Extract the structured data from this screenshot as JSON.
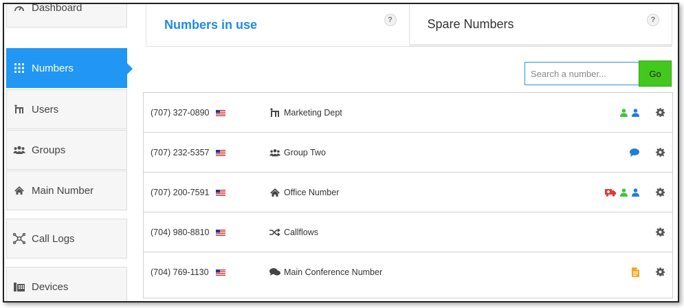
{
  "sidebar": {
    "items": [
      {
        "label": "Dashboard",
        "icon": "dashboard-icon"
      },
      {
        "label": "Numbers",
        "icon": "grid-icon",
        "active": true
      },
      {
        "label": "Users",
        "icon": "user-tree-icon"
      },
      {
        "label": "Groups",
        "icon": "group-icon"
      },
      {
        "label": "Main Number",
        "icon": "home-icon"
      },
      {
        "label": "Call Logs",
        "icon": "call-logs-icon"
      },
      {
        "label": "Devices",
        "icon": "device-icon"
      }
    ]
  },
  "tabs": [
    {
      "label": "Numbers in use",
      "help": "?"
    },
    {
      "label": "Spare Numbers",
      "help": "?"
    }
  ],
  "search": {
    "placeholder": "Search a number...",
    "go_label": "Go"
  },
  "numbers": [
    {
      "number": "(707) 327-0890",
      "owner": "Marketing Dept",
      "owner_icon": "user-tree-icon",
      "features": [
        "green-user-icon",
        "blue-user-icon"
      ]
    },
    {
      "number": "(707) 232-5357",
      "owner": "Group Two",
      "owner_icon": "group-icon",
      "features": [
        "chat-bubble-icon"
      ]
    },
    {
      "number": "(707) 200-7591",
      "owner": "Office Number",
      "owner_icon": "home-icon",
      "features": [
        "ambulance-icon",
        "green-user-icon",
        "blue-user-icon"
      ]
    },
    {
      "number": "(704) 980-8810",
      "owner": "Callflows",
      "owner_icon": "shuffle-icon",
      "features": []
    },
    {
      "number": "(704) 769-1130",
      "owner": "Main Conference Number",
      "owner_icon": "conference-icon",
      "features": [
        "document-icon"
      ]
    }
  ],
  "colors": {
    "accent": "#2196f3",
    "go": "#43c91e",
    "green_user": "#3cc53c",
    "blue_user": "#1e7fd6",
    "ambulance": "#e53935",
    "document": "#f5a623"
  }
}
